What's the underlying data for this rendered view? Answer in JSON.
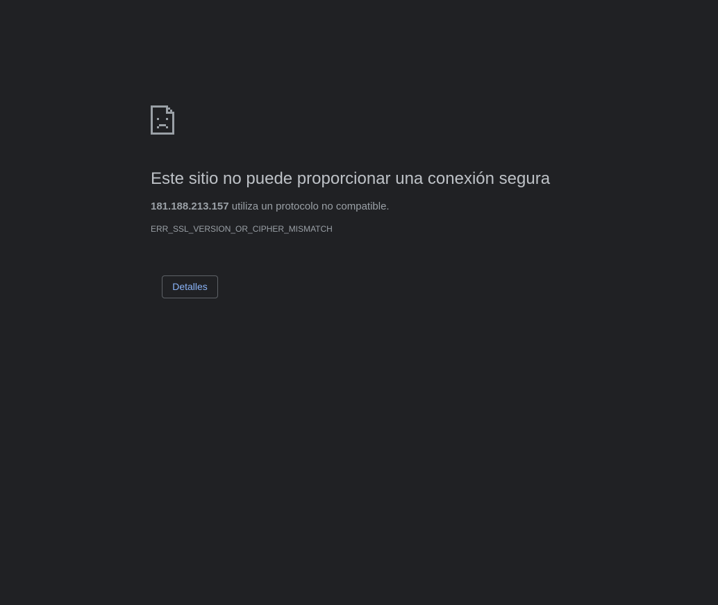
{
  "error": {
    "icon": "sad-page-icon",
    "title": "Este sitio no puede proporcionar una conexión segura",
    "host": "181.188.213.157",
    "description_suffix": " utiliza un protocolo no compatible.",
    "code": "ERR_SSL_VERSION_OR_CIPHER_MISMATCH"
  },
  "actions": {
    "details_label": "Detalles"
  },
  "colors": {
    "background": "#202124",
    "title": "#bdc1c6",
    "text": "#9aa0a6",
    "link": "#8ab4f8",
    "border": "#5f6368"
  }
}
